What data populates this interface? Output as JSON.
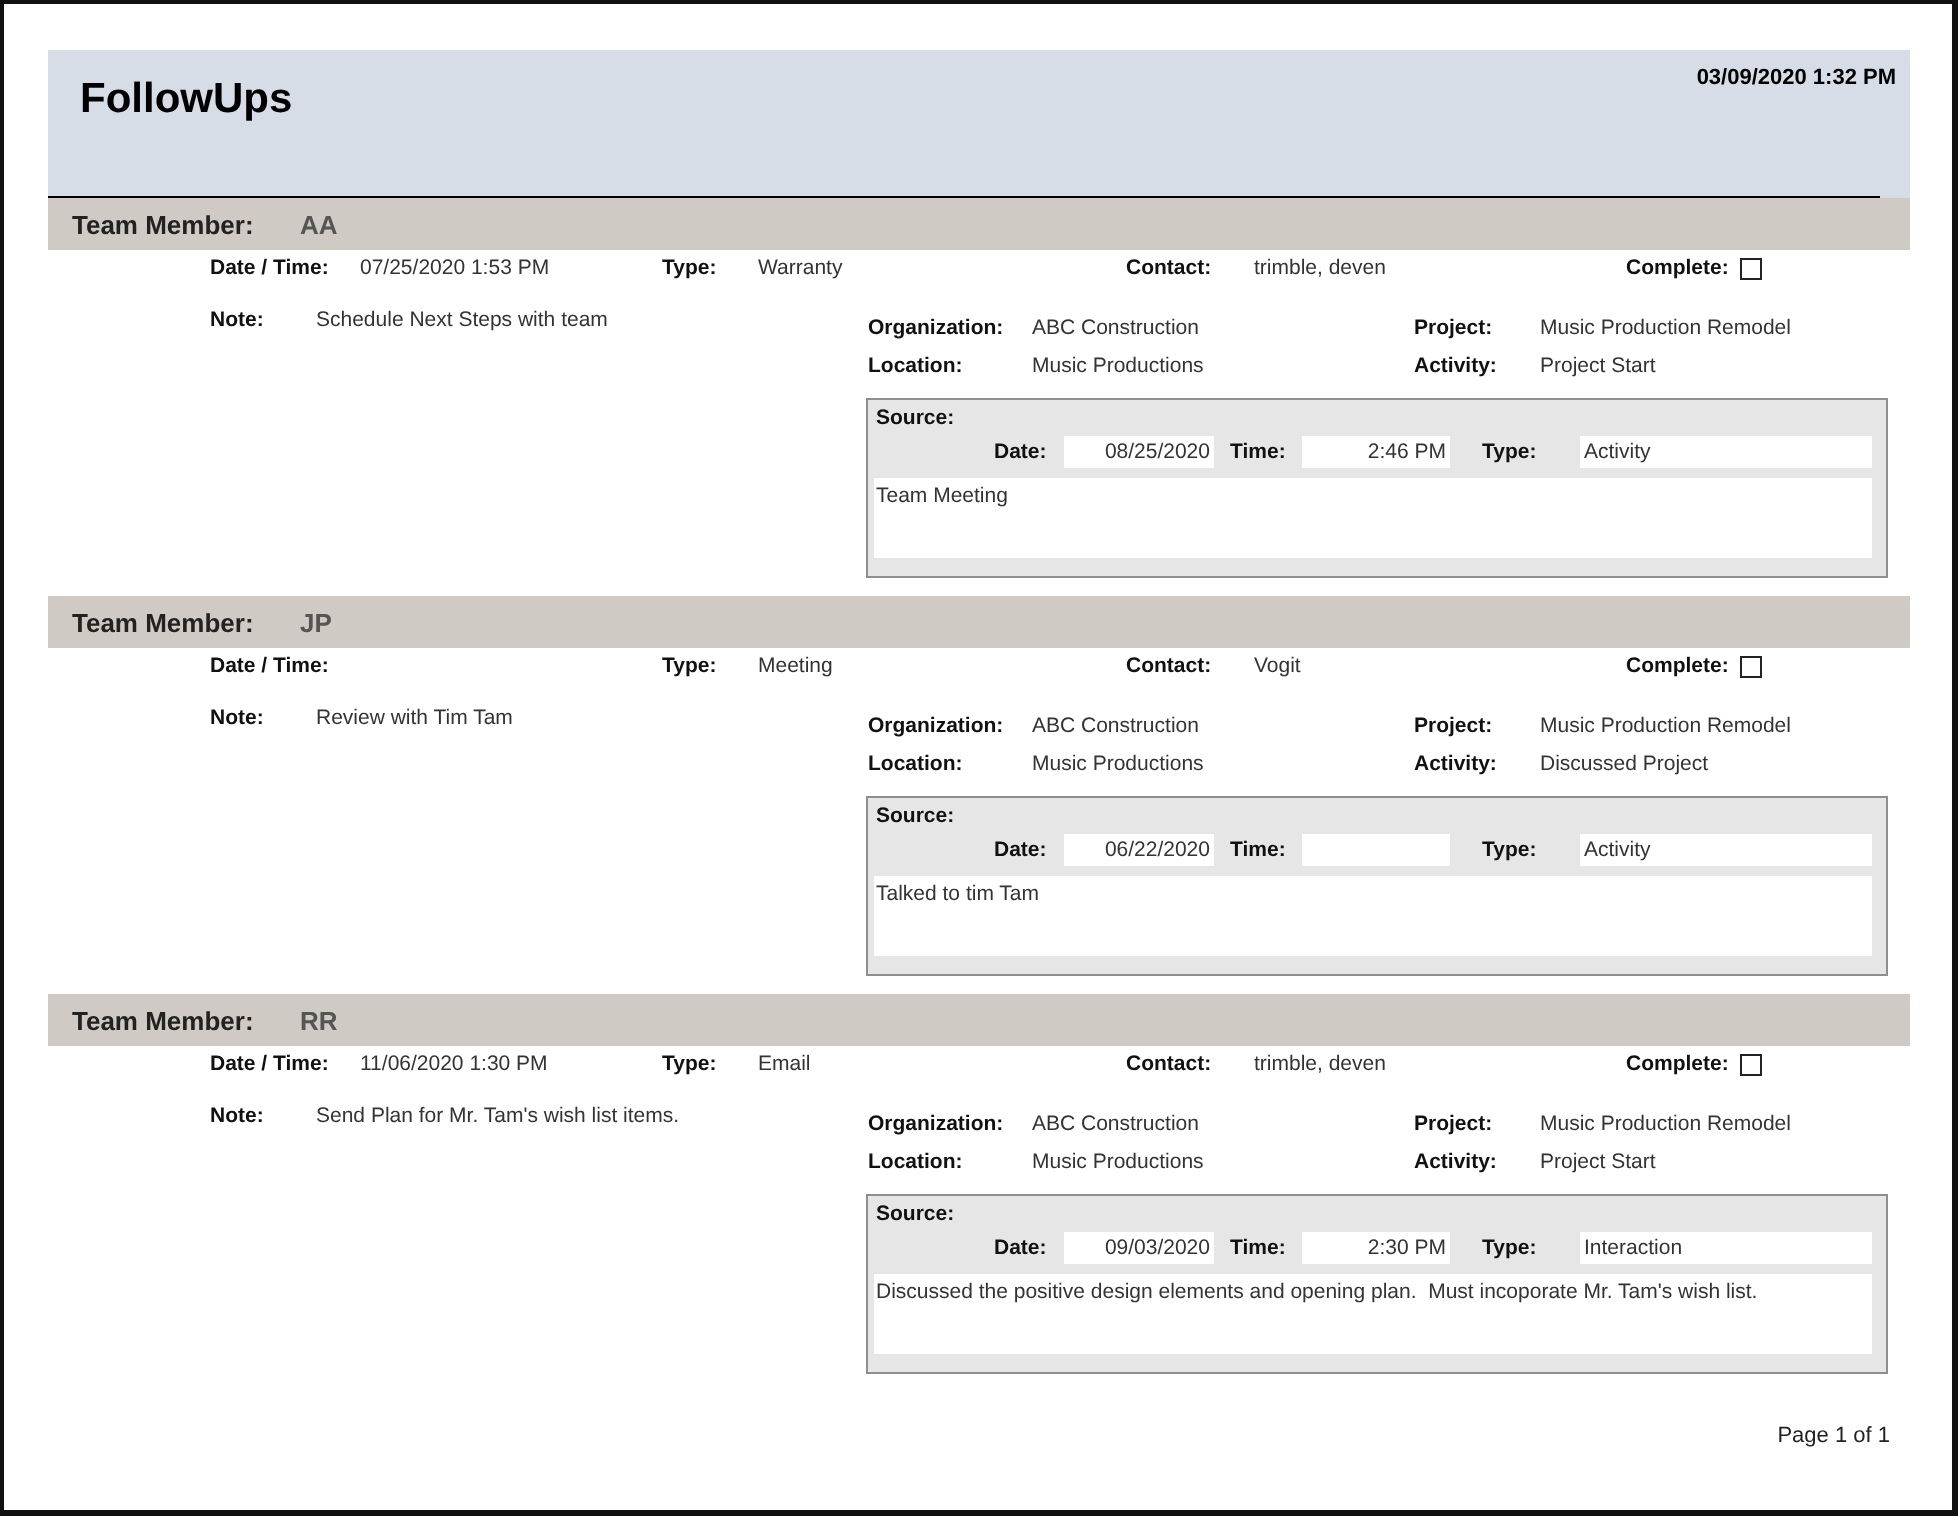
{
  "report": {
    "title": "FollowUps",
    "printed": "03/09/2020 1:32 PM"
  },
  "records": [
    {
      "member_label": "Team Member:",
      "member": "AA",
      "date_time": {
        "label": "Date / Time:",
        "value": "07/25/2020 1:53 PM"
      },
      "type": {
        "label": "Type:",
        "value": "Warranty"
      },
      "contact": {
        "label": "Contact:",
        "value": "trimble, deven"
      },
      "complete": {
        "label": "Complete:",
        "checked": false
      },
      "note": {
        "label": "Note:",
        "value": "Schedule Next Steps with team"
      },
      "organization": {
        "label": "Organization:",
        "value": "ABC Construction"
      },
      "project": {
        "label": "Project:",
        "value": "Music Production Remodel"
      },
      "location": {
        "label": "Location:",
        "value": "Music Productions"
      },
      "activity": {
        "label": "Activity:",
        "value": "Project Start"
      },
      "source": {
        "label": "Source:",
        "date": {
          "label": "Date:",
          "value": "08/25/2020"
        },
        "time": {
          "label": "Time:",
          "value": "2:46 PM"
        },
        "type": {
          "label": "Type:",
          "value": "Activity"
        },
        "text": "Team Meeting"
      }
    },
    {
      "member_label": "Team Member:",
      "member": "JP",
      "date_time": {
        "label": "Date / Time:"
      },
      "type": {
        "label": "Type:",
        "value": "Meeting"
      },
      "contact": {
        "label": "Contact:",
        "value": "Vogit"
      },
      "complete": {
        "label": "Complete:",
        "checked": false
      },
      "note": {
        "label": "Note:",
        "value": "Review with Tim Tam"
      },
      "organization": {
        "label": "Organization:",
        "value": "ABC Construction"
      },
      "project": {
        "label": "Project:",
        "value": "Music Production Remodel"
      },
      "location": {
        "label": "Location:",
        "value": "Music Productions"
      },
      "activity": {
        "label": "Activity:",
        "value": "Discussed Project"
      },
      "source": {
        "label": "Source:",
        "date": {
          "label": "Date:",
          "value": "06/22/2020"
        },
        "time": {
          "label": "Time:"
        },
        "type": {
          "label": "Type:",
          "value": "Activity"
        },
        "text": "Talked to tim Tam"
      }
    },
    {
      "member_label": "Team Member:",
      "member": "RR",
      "date_time": {
        "label": "Date / Time:",
        "value": "11/06/2020 1:30 PM"
      },
      "type": {
        "label": "Type:",
        "value": "Email"
      },
      "contact": {
        "label": "Contact:",
        "value": "trimble, deven"
      },
      "complete": {
        "label": "Complete:",
        "checked": false
      },
      "note": {
        "label": "Note:",
        "value": "Send Plan for Mr. Tam's wish list items."
      },
      "organization": {
        "label": "Organization:",
        "value": "ABC Construction"
      },
      "project": {
        "label": "Project:",
        "value": "Music Production Remodel"
      },
      "location": {
        "label": "Location:",
        "value": "Music Productions"
      },
      "activity": {
        "label": "Activity:",
        "value": "Project Start"
      },
      "source": {
        "label": "Source:",
        "date": {
          "label": "Date:",
          "value": "09/03/2020"
        },
        "time": {
          "label": "Time:",
          "value": "2:30 PM"
        },
        "type": {
          "label": "Type:",
          "value": "Interaction"
        },
        "text": "Discussed the positive design elements and opening plan.  Must incoporate Mr. Tam's wish list."
      }
    }
  ],
  "footer": {
    "page": "Page 1 of 1"
  }
}
